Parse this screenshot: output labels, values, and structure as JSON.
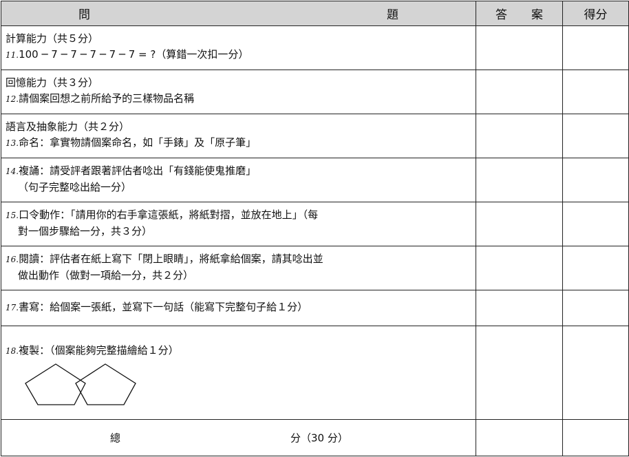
{
  "header": {
    "question_left": "問",
    "question_right": "題",
    "answer_left": "答",
    "answer_right": "案",
    "score": "得分"
  },
  "rows": [
    {
      "title": "計算能力（共５分）",
      "num": "11.",
      "text": "100 ─ 7 ─ 7 ─ 7 ─ 7 ─ 7 = ?（算錯一次扣一分）"
    },
    {
      "title": "回憶能力（共３分）",
      "num": "12.",
      "text": "請個案回想之前所給予的三樣物品名稱"
    },
    {
      "title": "語言及抽象能力（共２分）",
      "num": "13.",
      "text": "命名：拿實物請個案命名，如「手錶」及「原子筆」"
    },
    {
      "num": "14.",
      "text": "複誦：請受評者跟著評估者唸出「有錢能使鬼推磨」",
      "text2": "（句子完整唸出給一分）"
    },
    {
      "num": "15.",
      "text": "口令動作：「請用你的右手拿這張紙，將紙對摺，並放在地上」（每",
      "text2": "對一個步驟給一分，共３分）"
    },
    {
      "num": "16.",
      "text": "閱讀：評估者在紙上寫下「閉上眼睛」，將紙拿給個案，請其唸出並",
      "text2": "做出動作（做對一項給一分，共２分）"
    },
    {
      "num": "17.",
      "text": "書寫：給個案一張紙，並寫下一句話（能寫下完整句子給１分）"
    },
    {
      "num": "18.",
      "text": "複製：（個案能夠完整描繪給１分）"
    }
  ],
  "total": {
    "left": "總",
    "right": "分（30 分）"
  }
}
